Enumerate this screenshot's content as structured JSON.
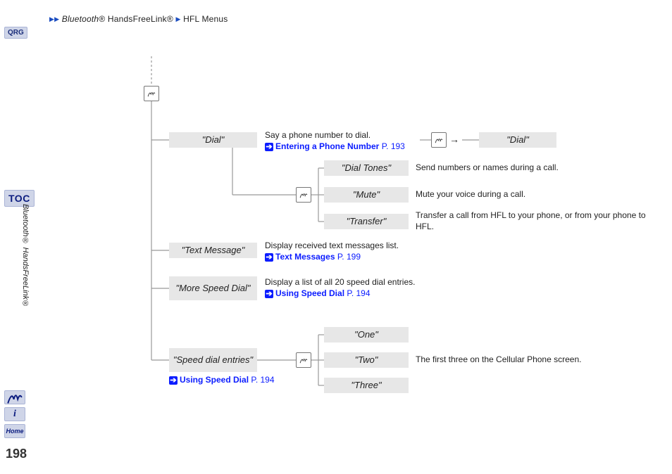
{
  "breadcrumb": {
    "a": "Bluetooth",
    "areg": "® HandsFreeLink®",
    "b": "HFL Menus"
  },
  "qrg": "QRG",
  "toc": "TOC",
  "side_label": "Bluetooth® HandsFreeLink®",
  "side": {
    "info": "i",
    "home": "Home"
  },
  "page": "198",
  "menu": {
    "dial": {
      "label": "\"Dial\"",
      "desc": "Say a phone number to dial.",
      "link_text": "Entering a Phone Number",
      "link_pg": "P. 193",
      "confirm_label": "\"Dial\""
    },
    "dial_tones": {
      "label": "\"Dial Tones\"",
      "desc": "Send numbers or names during a call."
    },
    "mute": {
      "label": "\"Mute\"",
      "desc": "Mute your voice during a call."
    },
    "transfer": {
      "label": "\"Transfer\"",
      "desc": "Transfer a call from HFL to your phone, or from your phone to HFL."
    },
    "text_msg": {
      "label": "\"Text Message\"",
      "desc": "Display received text messages list.",
      "link_text": "Text Messages",
      "link_pg": "P. 199"
    },
    "more_sd": {
      "label": "\"More Speed Dial\"",
      "desc": "Display a list of all 20 speed dial entries.",
      "link_text": "Using Speed Dial",
      "link_pg": "P. 194"
    },
    "sd_entries": {
      "label": "\"Speed dial entries\"",
      "link_text": "Using Speed Dial",
      "link_pg": "P. 194",
      "one": "\"One\"",
      "two": "\"Two\"",
      "three": "\"Three\"",
      "desc": "The first three on the Cellular Phone screen."
    }
  }
}
